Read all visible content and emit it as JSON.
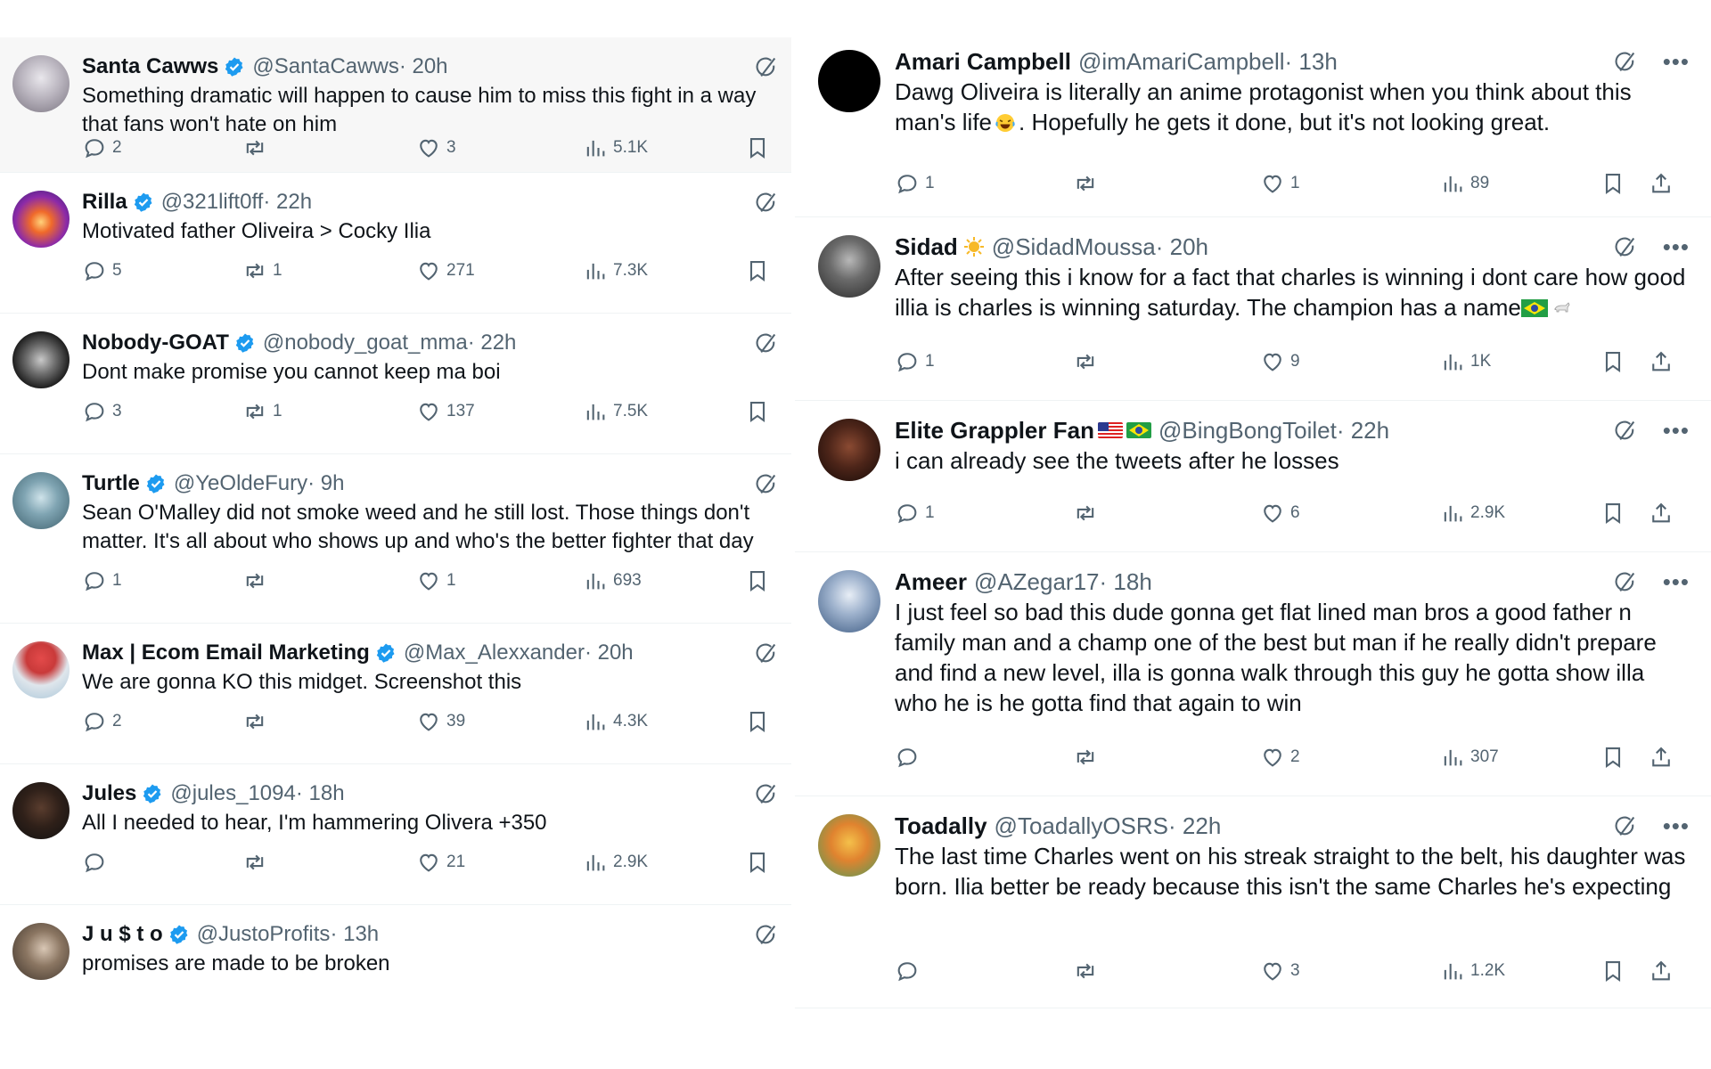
{
  "left": [
    {
      "name": "Santa Cawws",
      "verified": true,
      "handle": "@SantaCawws",
      "time": " · 20h",
      "text": "Something dramatic will happen to cause him to miss this fight in a way that fans won't hate on him",
      "replies": "2",
      "reposts": "",
      "likes": "3",
      "views": "5.1K"
    },
    {
      "name": "Rilla",
      "verified": true,
      "handle": "@321lift0ff",
      "time": " · 22h",
      "text": "Motivated father Oliveira > Cocky Ilia",
      "replies": "5",
      "reposts": "1",
      "likes": "271",
      "views": "7.3K"
    },
    {
      "name": "Nobody-GOAT",
      "verified": true,
      "handle": "@nobody_goat_mma",
      "time": " · 22h",
      "text": "Dont make promise you cannot keep ma boi",
      "replies": "3",
      "reposts": "1",
      "likes": "137",
      "views": "7.5K"
    },
    {
      "name": "Turtle",
      "verified": true,
      "handle": "@YeOldeFury",
      "time": " · 9h",
      "text": "Sean O'Malley did not smoke weed and he still lost. Those things don't matter. It's all about who shows up and who's the better fighter that day",
      "replies": "1",
      "reposts": "",
      "likes": "1",
      "views": "693"
    },
    {
      "name": "Max | Ecom Email Marketing",
      "verified": true,
      "handle": "@Max_Alexxander",
      "time": " · 20h",
      "text": "We are gonna KO this midget. Screenshot this",
      "replies": "2",
      "reposts": "",
      "likes": "39",
      "views": "4.3K"
    },
    {
      "name": "Jules",
      "verified": true,
      "handle": "@jules_1094",
      "time": " · 18h",
      "text": "All I needed to hear, I'm hammering Olivera +350",
      "replies": "",
      "reposts": "",
      "likes": "21",
      "views": "2.9K"
    },
    {
      "name": "J u $ t o",
      "verified": true,
      "handle": "@JustoProfits",
      "time": " · 13h",
      "text": "promises are made to be broken",
      "replies": "",
      "reposts": "",
      "likes": "",
      "views": ""
    }
  ],
  "right": [
    {
      "name": "Amari Campbell",
      "handle": "@imAmariCampbell",
      "time": " · 13h",
      "text_a": "Dawg Oliveira is literally an anime protagonist when you think about this man's life",
      "emoji_a": "laughing-crying",
      "text_b": ". Hopefully he gets it done, but it's not looking great.",
      "replies": "1",
      "reposts": "",
      "likes": "1",
      "views": "89"
    },
    {
      "name": "Sidad",
      "badge": "sun",
      "handle": "@SidadMoussa",
      "time": " · 20h",
      "text_a": "After seeing this i know for a fact that charles is winning i dont care how good illia is charles is winning saturday. The champion has a name",
      "emoji_a": "brazil-flag goat",
      "text_b": "",
      "replies": "1",
      "reposts": "",
      "likes": "9",
      "views": "1K"
    },
    {
      "name": "Elite Grappler Fan",
      "flags": "us brazil",
      "handle": "@BingBongToilet",
      "time": " · 22h",
      "text_a": "i can already see the tweets after he losses",
      "text_b": "",
      "replies": "1",
      "reposts": "",
      "likes": "6",
      "views": "2.9K"
    },
    {
      "name": "Ameer",
      "handle": "@AZegar17",
      "time": " · 18h",
      "text_a": "I just feel so bad this dude gonna get flat lined man bros a good father n family man and a champ one of the best but man if he really didn't prepare and find a new level, illa  is gonna walk through this guy he gotta show illa who he is he gotta find that again to win",
      "text_b": "",
      "replies": "",
      "reposts": "",
      "likes": "2",
      "views": "307"
    },
    {
      "name": "Toadally",
      "handle": "@ToadallyOSRS",
      "time": " · 22h",
      "text_a": "The last time Charles went on his streak straight to the belt, his daughter was born. Ilia better be ready because this isn't the same Charles he's expecting",
      "text_b": "",
      "replies": "",
      "reposts": "",
      "likes": "3",
      "views": "1.2K"
    }
  ],
  "icons": {
    "reply": "reply-icon",
    "repost": "repost-icon",
    "like": "like-icon",
    "views": "views-icon",
    "bookmark": "bookmark-icon",
    "share": "share-icon",
    "grok": "grok-icon",
    "more": "more-icon"
  },
  "colors": {
    "verified": "#1d9bf0",
    "secondary": "#536471",
    "text": "#0f1419"
  }
}
